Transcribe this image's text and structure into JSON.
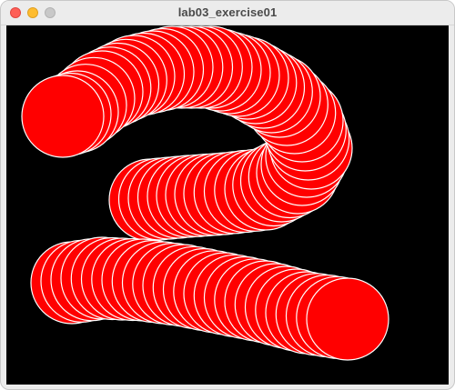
{
  "window": {
    "title": "lab03_exercise01"
  },
  "titlebar_buttons": {
    "close": "close-icon",
    "minimize": "minimize-icon",
    "zoom": "zoom-icon"
  },
  "canvas": {
    "background_color": "#000000",
    "circle_fill": "#ff0000",
    "circle_stroke": "#ffffff"
  }
}
